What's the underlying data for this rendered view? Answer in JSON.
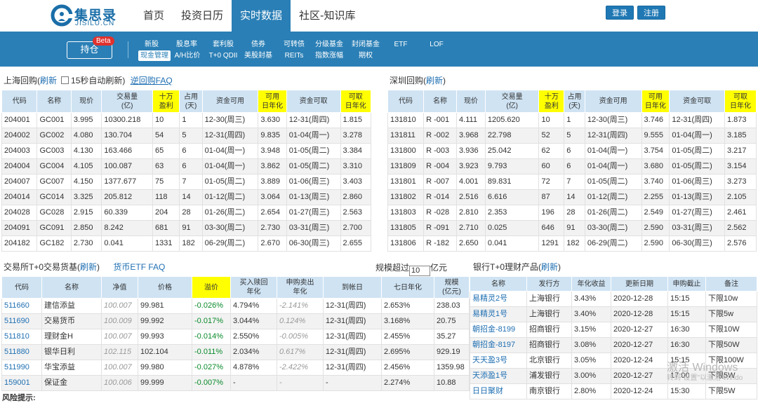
{
  "header": {
    "logo_cn": "集思录",
    "logo_en": "JISILU.CN",
    "nav": [
      "首页",
      "投资日历",
      "实时数据",
      "社区-知识库"
    ],
    "nav_active": 2,
    "login": "登录",
    "register": "注册"
  },
  "subnav": {
    "hold": "持仓",
    "beta": "Beta",
    "row1": [
      "新股",
      "股息率",
      "套利股",
      "债券",
      "可转债",
      "分级基金",
      "封闭基金",
      "ETF",
      "LOF"
    ],
    "row2": [
      "现金管理",
      "A/H比价",
      "T+0 QDII",
      "美股封基",
      "REITs",
      "指数涨幅",
      "期权"
    ],
    "active": "现金管理"
  },
  "sh_repo": {
    "title": "上海回购(",
    "refresh": "刷新",
    "auto": "15秒自动刷新)",
    "faq": "逆回购FAQ",
    "headers": [
      "代码",
      "名称",
      "现价",
      "交易量\n(亿)",
      "十万\n盈利",
      "占用\n(天)",
      "资金可用",
      "可用\n日年化",
      "资金可取",
      "可取\n日年化"
    ],
    "rows": [
      [
        "204001",
        "GC001",
        "3.995",
        "10300.218",
        "10",
        "1",
        "12-30(周三)",
        "3.630",
        "12-31(周四)",
        "1.815"
      ],
      [
        "204002",
        "GC002",
        "4.080",
        "130.704",
        "54",
        "5",
        "12-31(周四)",
        "9.835",
        "01-04(周一)",
        "3.278"
      ],
      [
        "204003",
        "GC003",
        "4.130",
        "163.466",
        "65",
        "6",
        "01-04(周一)",
        "3.948",
        "01-05(周二)",
        "3.384"
      ],
      [
        "204004",
        "GC004",
        "4.105",
        "100.087",
        "63",
        "6",
        "01-04(周一)",
        "3.862",
        "01-05(周二)",
        "3.310"
      ],
      [
        "204007",
        "GC007",
        "4.150",
        "1377.677",
        "75",
        "7",
        "01-05(周二)",
        "3.889",
        "01-06(周三)",
        "3.403"
      ],
      [
        "204014",
        "GC014",
        "3.325",
        "205.812",
        "118",
        "14",
        "01-12(周二)",
        "3.064",
        "01-13(周三)",
        "2.860"
      ],
      [
        "204028",
        "GC028",
        "2.915",
        "60.339",
        "204",
        "28",
        "01-26(周二)",
        "2.654",
        "01-27(周三)",
        "2.563"
      ],
      [
        "204091",
        "GC091",
        "2.850",
        "8.242",
        "681",
        "91",
        "03-30(周二)",
        "2.730",
        "03-31(周三)",
        "2.700"
      ],
      [
        "204182",
        "GC182",
        "2.730",
        "0.041",
        "1331",
        "182",
        "06-29(周二)",
        "2.670",
        "06-30(周三)",
        "2.655"
      ]
    ]
  },
  "sz_repo": {
    "title": "深圳回购(",
    "refresh": "刷新",
    "close": ")",
    "headers": [
      "代码",
      "名称",
      "现价",
      "交易量\n(亿)",
      "十万\n盈利",
      "占用\n(天)",
      "资金可用",
      "可用\n日年化",
      "资金可取",
      "可取\n日年化"
    ],
    "rows": [
      [
        "131810",
        "R -001",
        "4.111",
        "1205.620",
        "10",
        "1",
        "12-30(周三)",
        "3.746",
        "12-31(周四)",
        "1.873"
      ],
      [
        "131811",
        "R -002",
        "3.968",
        "22.798",
        "52",
        "5",
        "12-31(周四)",
        "9.555",
        "01-04(周一)",
        "3.185"
      ],
      [
        "131800",
        "R -003",
        "3.936",
        "25.042",
        "62",
        "6",
        "01-04(周一)",
        "3.754",
        "01-05(周二)",
        "3.217"
      ],
      [
        "131809",
        "R -004",
        "3.923",
        "9.793",
        "60",
        "6",
        "01-04(周一)",
        "3.680",
        "01-05(周二)",
        "3.154"
      ],
      [
        "131801",
        "R -007",
        "4.001",
        "89.831",
        "72",
        "7",
        "01-05(周二)",
        "3.740",
        "01-06(周三)",
        "3.273"
      ],
      [
        "131802",
        "R -014",
        "2.516",
        "6.616",
        "87",
        "14",
        "01-12(周二)",
        "2.255",
        "01-13(周三)",
        "2.105"
      ],
      [
        "131803",
        "R -028",
        "2.810",
        "2.353",
        "196",
        "28",
        "01-26(周二)",
        "2.549",
        "01-27(周三)",
        "2.461"
      ],
      [
        "131805",
        "R -091",
        "2.710",
        "0.025",
        "646",
        "91",
        "03-30(周二)",
        "2.590",
        "03-31(周三)",
        "2.562"
      ],
      [
        "131806",
        "R -182",
        "2.650",
        "0.041",
        "1291",
        "182",
        "06-29(周二)",
        "2.590",
        "06-30(周三)",
        "2.576"
      ]
    ]
  },
  "mmf": {
    "title": "交易所T+0交易货基(",
    "refresh": "刷新",
    "close": ")",
    "faq": "货币ETF FAQ",
    "filter_label": "规模超过",
    "filter_value": "10",
    "filter_unit": "亿元",
    "headers": [
      "代码",
      "名称",
      "净值",
      "价格",
      "溢价",
      "买入赎回\n年化",
      "申购卖出\n年化",
      "到帐日",
      "七日年化",
      "规模\n(亿元)"
    ],
    "rows": [
      [
        "511660",
        "建信添益",
        "100.007",
        "99.981",
        "-0.026%",
        "4.794%",
        "-2.141%",
        "12-31(周四)",
        "2.653%",
        "238.03"
      ],
      [
        "511690",
        "交易货币",
        "100.009",
        "99.992",
        "-0.017%",
        "3.044%",
        "0.124%",
        "12-31(周四)",
        "3.168%",
        "20.75"
      ],
      [
        "511810",
        "理财金H",
        "100.007",
        "99.993",
        "-0.014%",
        "2.550%",
        "-0.005%",
        "12-31(周四)",
        "2.455%",
        "35.27"
      ],
      [
        "511880",
        "银华日利",
        "102.115",
        "102.104",
        "-0.011%",
        "2.034%",
        "0.617%",
        "12-31(周四)",
        "2.695%",
        "929.19"
      ],
      [
        "511990",
        "华宝添益",
        "100.007",
        "99.980",
        "-0.027%",
        "4.878%",
        "-2.422%",
        "12-31(周四)",
        "2.456%",
        "1359.98"
      ],
      [
        "159001",
        "保证金",
        "100.006",
        "99.999",
        "-0.007%",
        "-",
        "-",
        "-",
        "2.274%",
        "10.88"
      ]
    ]
  },
  "bank": {
    "title": "银行T+0理财产品(",
    "refresh": "刷新",
    "close": ")",
    "headers": [
      "名称",
      "发行方",
      "年化收益",
      "更新日期",
      "申购截止",
      "备注"
    ],
    "rows": [
      [
        "易精灵2号",
        "上海银行",
        "3.43%",
        "2020-12-28",
        "15:15",
        "下限10w"
      ],
      [
        "易精灵1号",
        "上海银行",
        "3.40%",
        "2020-12-28",
        "15:15",
        "下限5w"
      ],
      [
        "朝招金-8199",
        "招商银行",
        "3.15%",
        "2020-12-27",
        "16:30",
        "下限10W"
      ],
      [
        "朝招金-8197",
        "招商银行",
        "3.08%",
        "2020-12-27",
        "16:30",
        "下限50W"
      ],
      [
        "天天盈3号",
        "北京银行",
        "3.05%",
        "2020-12-24",
        "15:15",
        "下限100W"
      ],
      [
        "天添盈1号",
        "浦发银行",
        "3.00%",
        "2020-12-27",
        "17:00",
        "下限5W"
      ],
      [
        "日日聚财",
        "南京银行",
        "2.80%",
        "2020-12-24",
        "15:30",
        "下限5W"
      ]
    ]
  },
  "footer": {
    "risk": "风险提示:"
  },
  "overlay": {
    "win_line1": "激活 Windows",
    "win_line2": "转到\"设置\"以激活 Windo"
  },
  "colors": {
    "brand": "#2a7fb6",
    "header_cell": "#cfe3f3",
    "highlight": "#ffff00",
    "link": "#1f6fb2",
    "positive": "#0a8a2a"
  }
}
